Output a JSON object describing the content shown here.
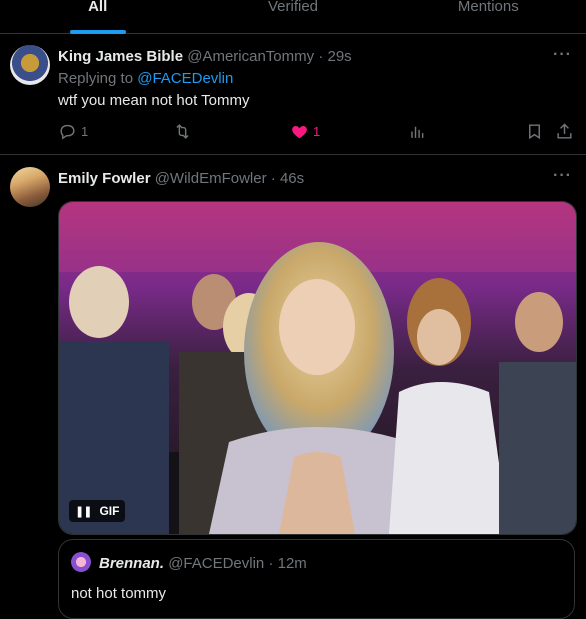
{
  "tabs": [
    {
      "label": "All",
      "active": true
    },
    {
      "label": "Verified",
      "active": false
    },
    {
      "label": "Mentions",
      "active": false
    }
  ],
  "tweets": [
    {
      "name": "King James Bible",
      "handle": "@AmericanTommy",
      "sep": "·",
      "time": "29s",
      "replying_prefix": "Replying to",
      "replying_to": "@FACEDevlin",
      "text": "wtf you mean not hot Tommy",
      "actions": {
        "reply_count": "1",
        "retweet_count": "",
        "like_count": "1",
        "liked": true,
        "like_color": "#f91880"
      },
      "avatar": "user-avatar"
    },
    {
      "name": "Emily Fowler",
      "handle": "@WildEmFowler",
      "sep": "·",
      "time": "46s",
      "media": {
        "type": "gif",
        "badge": "GIF",
        "pause_glyph": "❚❚"
      },
      "quote": {
        "name": "Brennan.",
        "handle": "@FACEDevlin",
        "sep": "·",
        "time": "12m",
        "text": "not hot tommy"
      }
    }
  ],
  "more_glyph": "···",
  "colors": {
    "accent": "#1d9bf0",
    "background": "#000000",
    "muted": "#71767b",
    "text": "#e7e9ea",
    "like": "#f91880"
  }
}
